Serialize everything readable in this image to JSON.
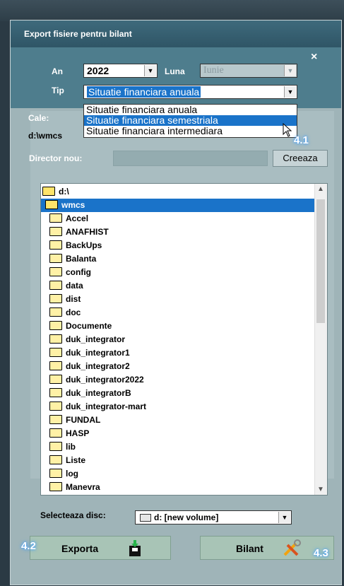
{
  "window": {
    "title": "Export fisiere pentru bilant"
  },
  "filters": {
    "an_label": "An",
    "an_value": "2022",
    "luna_label": "Luna",
    "luna_value": "Iunie",
    "tip_label": "Tip",
    "tip_value": "Situatie financiara anuala"
  },
  "dropdown": {
    "options": [
      "Situatie financiara anuala",
      "Situatie financiara semestriala",
      "Situatie financiara intermediara"
    ],
    "highlighted_index": 1
  },
  "path": {
    "cale_label": "Cale:",
    "current": "d:\\wmcs"
  },
  "new_dir": {
    "label": "Director nou:",
    "value": "",
    "create_button": "Creeaza"
  },
  "tree": {
    "root": "d:\\",
    "selected": "wmcs",
    "children": [
      "Accel",
      "ANAFHIST",
      "BackUps",
      "Balanta",
      "config",
      "data",
      "dist",
      "doc",
      "Documente",
      "duk_integrator",
      "duk_integrator1",
      "duk_integrator2",
      "duk_integrator2022",
      "duk_integratorB",
      "duk_integrator-mart",
      "FUNDAL",
      "HASP",
      "lib",
      "Liste",
      "log",
      "Manevra"
    ]
  },
  "disc": {
    "label": "Selecteaza disc:",
    "value": "d: [new volume]"
  },
  "buttons": {
    "export": "Exporta",
    "bilant": "Bilant"
  },
  "badges": {
    "b41": "4.1",
    "b42": "4.2",
    "b43": "4.3"
  },
  "close_glyph": "×",
  "colors": {
    "highlight": "#1a73c9",
    "title": "#2f5566",
    "button": "#a8c4b6"
  }
}
